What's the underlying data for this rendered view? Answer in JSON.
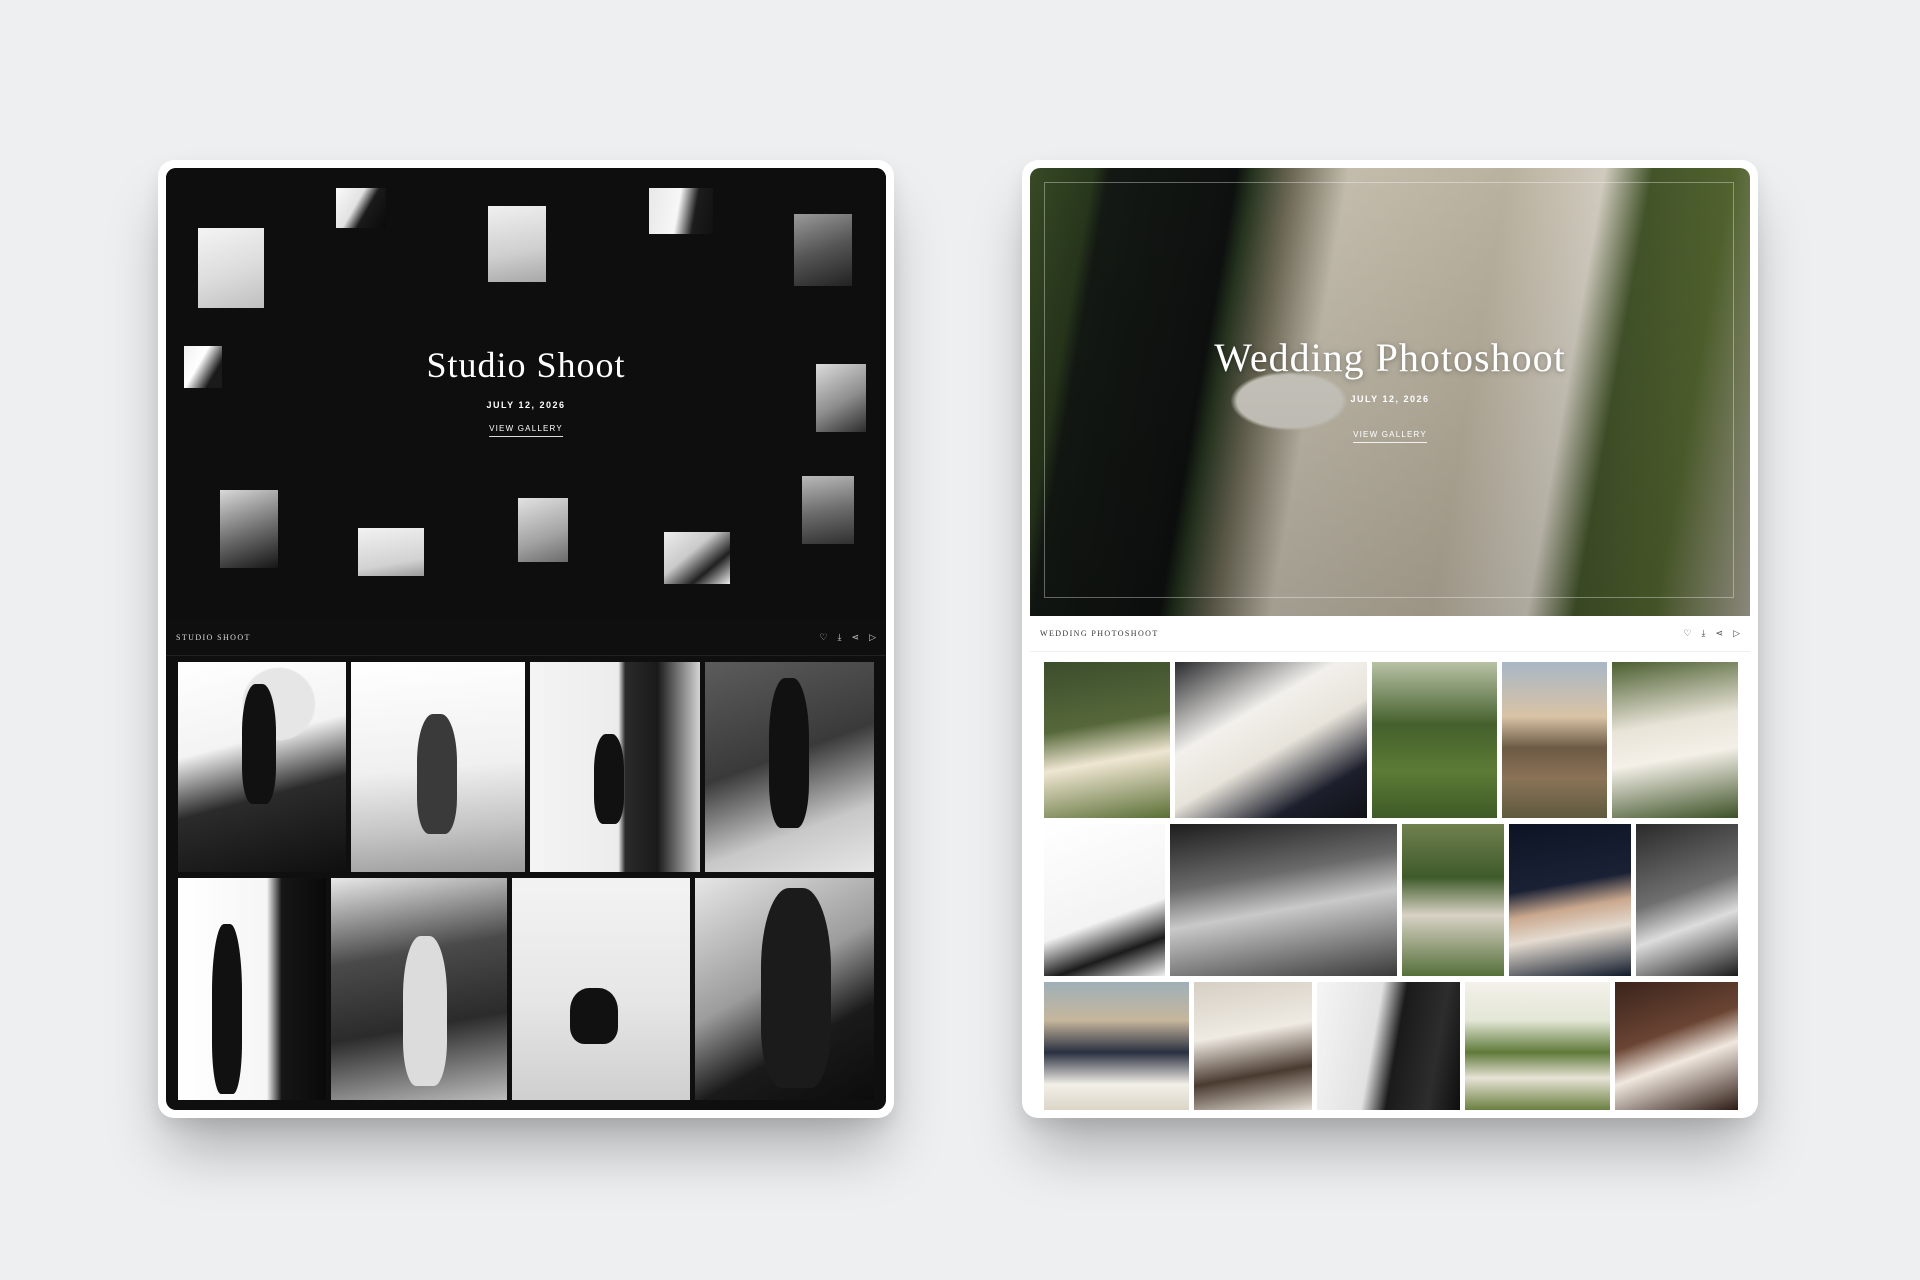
{
  "studio": {
    "hero_title": "Studio Shoot",
    "date": "JULY 12, 2026",
    "cta": "VIEW GALLERY",
    "bar_title": "STUDIO SHOOT",
    "icons": [
      "heart-icon",
      "download-icon",
      "share-icon",
      "play-icon"
    ]
  },
  "wedding": {
    "hero_title": "Wedding Photoshoot",
    "date": "JULY 12, 2026",
    "cta": "VIEW GALLERY",
    "bar_title": "WEDDING PHOTOSHOOT",
    "icons": [
      "heart-icon",
      "download-icon",
      "share-icon",
      "play-icon"
    ]
  },
  "glyphs": {
    "heart": "♡",
    "download": "⤓",
    "share": "⋖",
    "play": "▷"
  }
}
